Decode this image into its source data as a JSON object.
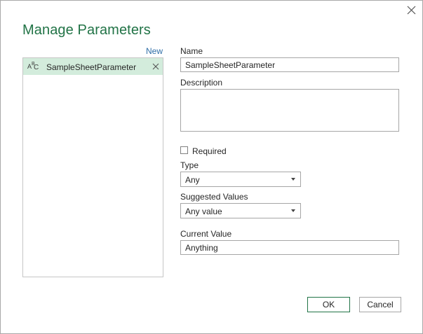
{
  "dialog": {
    "title": "Manage Parameters",
    "accent_color": "#217346",
    "close_icon": "close-icon"
  },
  "params_list": {
    "new_label": "New",
    "items": [
      {
        "type_icon": "text-type-icon",
        "type_glyph": "ABC",
        "name": "SampleSheetParameter",
        "selected": true
      }
    ],
    "selected_color": "#d3ecdc"
  },
  "form": {
    "name_label": "Name",
    "name_value": "SampleSheetParameter",
    "description_label": "Description",
    "description_value": "",
    "required_label": "Required",
    "required_checked": false,
    "type_label": "Type",
    "type_value": "Any",
    "suggested_label": "Suggested Values",
    "suggested_value": "Any value",
    "current_label": "Current Value",
    "current_value": "Anything"
  },
  "footer": {
    "ok_label": "OK",
    "cancel_label": "Cancel"
  }
}
